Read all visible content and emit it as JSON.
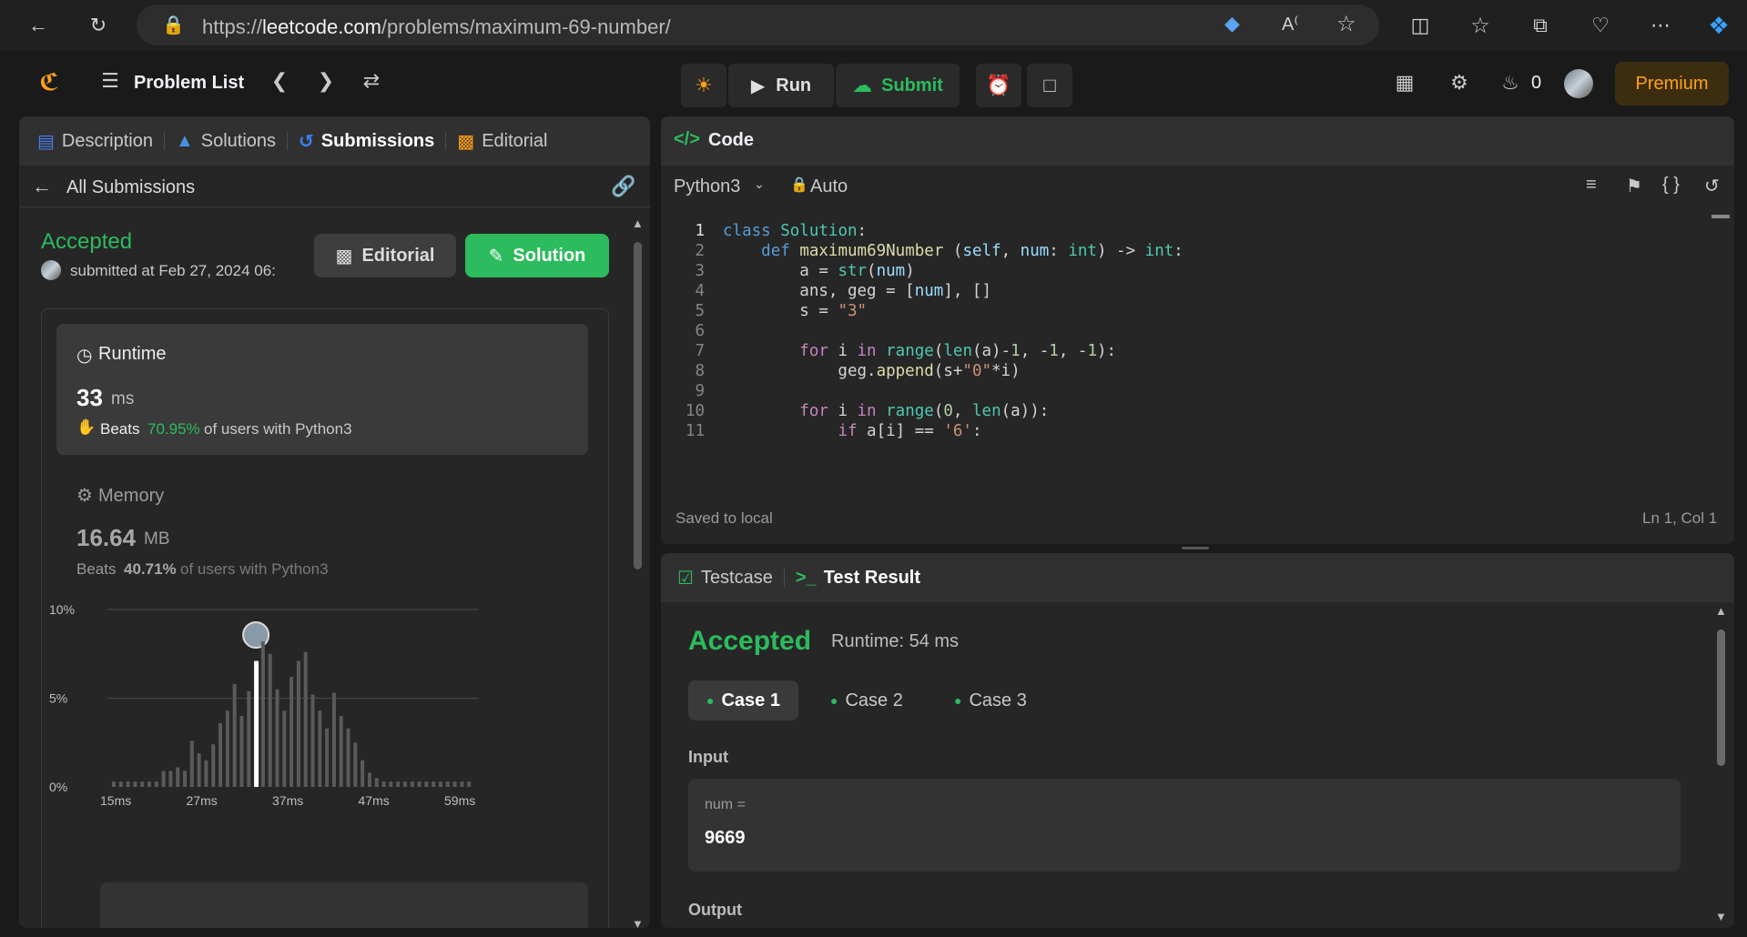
{
  "browser": {
    "url_prefix": "https://",
    "url_domain": "leetcode.com",
    "url_path": "/problems/maximum-69-number/"
  },
  "nav": {
    "problem_list": "Problem List",
    "run": "Run",
    "submit": "Submit",
    "streak": "0",
    "premium": "Premium"
  },
  "left_tabs": [
    "Description",
    "Solutions",
    "Submissions",
    "Editorial"
  ],
  "submission": {
    "back_label": "All Submissions",
    "status": "Accepted",
    "submitted": "submitted at Feb 27, 2024 06:",
    "editorial_btn": "Editorial",
    "solution_btn": "Solution",
    "runtime_title": "Runtime",
    "runtime_value": "33",
    "runtime_unit": "ms",
    "runtime_beats_label": "Beats",
    "runtime_beats": "70.95%",
    "runtime_beats_suffix": "of users with Python3",
    "memory_title": "Memory",
    "memory_value": "16.64",
    "memory_unit": "MB",
    "memory_beats_label": "Beats",
    "memory_beats": "40.71%",
    "memory_beats_suffix": "of users with Python3"
  },
  "chart_data": {
    "type": "bar",
    "y_ticks": [
      "10%",
      "5%",
      "0%"
    ],
    "ylim": [
      0,
      10
    ],
    "x_ticks": [
      "15ms",
      "27ms",
      "37ms",
      "47ms",
      "59ms"
    ],
    "values": [
      0.3,
      0.3,
      0.3,
      0.3,
      0.3,
      0.3,
      0.3,
      0.9,
      0.9,
      1.1,
      0.9,
      2.6,
      1.9,
      1.5,
      2.4,
      3.6,
      4.3,
      5.8,
      4.0,
      5.4,
      7.1,
      8.2,
      7.5,
      5.5,
      4.3,
      6.2,
      7.1,
      7.6,
      5.2,
      4.3,
      3.3,
      5.3,
      4.0,
      3.3,
      2.5,
      1.5,
      0.8,
      0.5,
      0.3,
      0.3,
      0.3,
      0.3,
      0.3,
      0.3,
      0.3,
      0.3,
      0.3,
      0.3,
      0.3,
      0.3,
      0.3
    ],
    "highlight_index": 20
  },
  "code": {
    "title": "Code",
    "language": "Python3",
    "mode": "Auto",
    "status": "Saved to local",
    "cursor": "Ln 1, Col 1",
    "lines": [
      "class Solution:",
      "    def maximum69Number (self, num: int) -> int:",
      "        a = str(num)",
      "        ans, geg = [num], []",
      "        s = \"3\"",
      "",
      "        for i in range(len(a)-1, -1, -1):",
      "            geg.append(s+\"0\"*i)",
      "",
      "        for i in range(0, len(a)):",
      "            if a[i] == '6':"
    ]
  },
  "test": {
    "tab_testcase": "Testcase",
    "tab_result": "Test Result",
    "status": "Accepted",
    "runtime": "Runtime: 54 ms",
    "cases": [
      "Case 1",
      "Case 2",
      "Case 3"
    ],
    "input_label": "Input",
    "var_label": "num =",
    "var_value": "9669",
    "output_label": "Output"
  },
  "colors": {
    "accent_green": "#2cbb5d",
    "premium": "#ffa116",
    "tab_blue": "#3b82f6"
  }
}
